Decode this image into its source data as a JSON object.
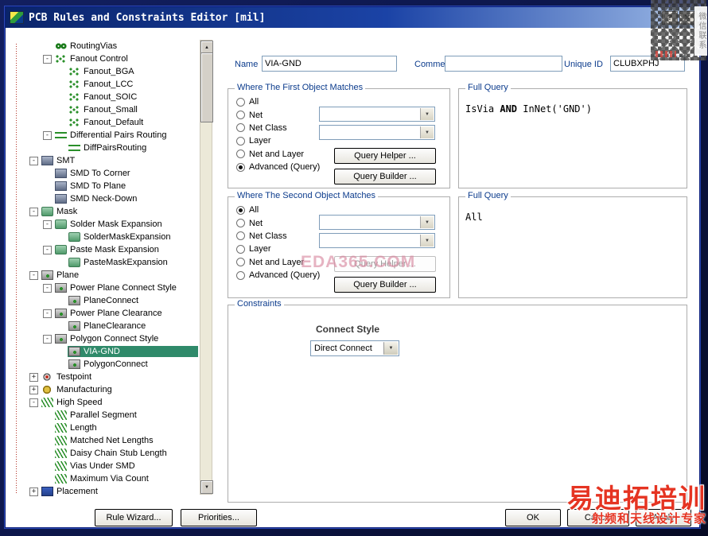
{
  "window": {
    "title": "PCB Rules and Constraints Editor [mil]",
    "help_label": "?",
    "close_label": "✕"
  },
  "form": {
    "name_label": "Name",
    "name_value": "VIA-GND",
    "comment_label": "Comment",
    "comment_value": "",
    "unique_id_label": "Unique ID",
    "unique_id_value": "CLUBXPHJ"
  },
  "first_match": {
    "title": "Where The First Object Matches",
    "options": [
      "All",
      "Net",
      "Net Class",
      "Layer",
      "Net and Layer",
      "Advanced (Query)"
    ],
    "selected": "Advanced (Query)",
    "query_helper_label": "Query Helper ...",
    "query_builder_label": "Query Builder ..."
  },
  "first_query": {
    "title": "Full Query",
    "prefix": "IsVia ",
    "keyword": "AND",
    "suffix": " InNet('GND')"
  },
  "second_match": {
    "title": "Where The Second Object Matches",
    "options": [
      "All",
      "Net",
      "Net Class",
      "Layer",
      "Net and Layer",
      "Advanced (Query)"
    ],
    "selected": "All",
    "query_helper_label": "Query Helper ...",
    "query_builder_label": "Query Builder ..."
  },
  "second_query": {
    "title": "Full Query",
    "text": "All"
  },
  "constraints": {
    "title": "Constraints",
    "connect_style_label": "Connect Style",
    "connect_style_value": "Direct Connect"
  },
  "footer": {
    "rule_wizard_label": "Rule Wizard...",
    "priorities_label": "Priorities...",
    "ok_label": "OK",
    "cancel_label": "Cancel",
    "apply_label": "Apply"
  },
  "watermarks": {
    "center_text": "EDA365.COM",
    "qr_caption": "微信联系",
    "brand_title": "易迪拓培训",
    "brand_subtitle": "射频和天线设计专家"
  },
  "tree": {
    "items": [
      {
        "label": "RoutingVias",
        "level": 2,
        "expand": null,
        "icon": "vias",
        "selected": false
      },
      {
        "label": "Fanout Control",
        "level": 2,
        "expand": "minus",
        "icon": "fanout",
        "selected": false
      },
      {
        "label": "Fanout_BGA",
        "level": 3,
        "expand": null,
        "icon": "fanout",
        "selected": false
      },
      {
        "label": "Fanout_LCC",
        "level": 3,
        "expand": null,
        "icon": "fanout",
        "selected": false
      },
      {
        "label": "Fanout_SOIC",
        "level": 3,
        "expand": null,
        "icon": "fanout",
        "selected": false
      },
      {
        "label": "Fanout_Small",
        "level": 3,
        "expand": null,
        "icon": "fanout",
        "selected": false
      },
      {
        "label": "Fanout_Default",
        "level": 3,
        "expand": null,
        "icon": "fanout",
        "selected": false
      },
      {
        "label": "Differential Pairs Routing",
        "level": 2,
        "expand": "minus",
        "icon": "diffpairs",
        "selected": false
      },
      {
        "label": "DiffPairsRouting",
        "level": 3,
        "expand": null,
        "icon": "diffpairs",
        "selected": false
      },
      {
        "label": "SMT",
        "level": 1,
        "expand": "minus",
        "icon": "smt",
        "selected": false
      },
      {
        "label": "SMD To Corner",
        "level": 2,
        "expand": null,
        "icon": "smt",
        "selected": false
      },
      {
        "label": "SMD To Plane",
        "level": 2,
        "expand": null,
        "icon": "smt",
        "selected": false
      },
      {
        "label": "SMD Neck-Down",
        "level": 2,
        "expand": null,
        "icon": "smt",
        "selected": false
      },
      {
        "label": "Mask",
        "level": 1,
        "expand": "minus",
        "icon": "mask",
        "selected": false
      },
      {
        "label": "Solder Mask Expansion",
        "level": 2,
        "expand": "minus",
        "icon": "mask",
        "selected": false
      },
      {
        "label": "SolderMaskExpansion",
        "level": 3,
        "expand": null,
        "icon": "mask",
        "selected": false
      },
      {
        "label": "Paste Mask Expansion",
        "level": 2,
        "expand": "minus",
        "icon": "mask",
        "selected": false
      },
      {
        "label": "PasteMaskExpansion",
        "level": 3,
        "expand": null,
        "icon": "mask",
        "selected": false
      },
      {
        "label": "Plane",
        "level": 1,
        "expand": "minus",
        "icon": "plane",
        "selected": false
      },
      {
        "label": "Power Plane Connect Style",
        "level": 2,
        "expand": "minus",
        "icon": "plane",
        "selected": false
      },
      {
        "label": "PlaneConnect",
        "level": 3,
        "expand": null,
        "icon": "plane",
        "selected": false
      },
      {
        "label": "Power Plane Clearance",
        "level": 2,
        "expand": "minus",
        "icon": "plane",
        "selected": false
      },
      {
        "label": "PlaneClearance",
        "level": 3,
        "expand": null,
        "icon": "plane",
        "selected": false
      },
      {
        "label": "Polygon Connect Style",
        "level": 2,
        "expand": "minus",
        "icon": "plane",
        "selected": false
      },
      {
        "label": "VIA-GND",
        "level": 3,
        "expand": null,
        "icon": "plane",
        "selected": true
      },
      {
        "label": "PolygonConnect",
        "level": 3,
        "expand": null,
        "icon": "plane",
        "selected": false
      },
      {
        "label": "Testpoint",
        "level": 1,
        "expand": "plus",
        "icon": "testpoint",
        "selected": false
      },
      {
        "label": "Manufacturing",
        "level": 1,
        "expand": "plus",
        "icon": "manufacturing",
        "selected": false
      },
      {
        "label": "High Speed",
        "level": 1,
        "expand": "minus",
        "icon": "highspeed",
        "selected": false
      },
      {
        "label": "Parallel Segment",
        "level": 2,
        "expand": null,
        "icon": "highspeed",
        "selected": false
      },
      {
        "label": "Length",
        "level": 2,
        "expand": null,
        "icon": "highspeed",
        "selected": false
      },
      {
        "label": "Matched Net Lengths",
        "level": 2,
        "expand": null,
        "icon": "highspeed",
        "selected": false
      },
      {
        "label": "Daisy Chain Stub Length",
        "level": 2,
        "expand": null,
        "icon": "highspeed",
        "selected": false
      },
      {
        "label": "Vias Under SMD",
        "level": 2,
        "expand": null,
        "icon": "highspeed",
        "selected": false
      },
      {
        "label": "Maximum Via Count",
        "level": 2,
        "expand": null,
        "icon": "highspeed",
        "selected": false
      },
      {
        "label": "Placement",
        "level": 1,
        "expand": "plus",
        "icon": "placement",
        "selected": false
      }
    ]
  }
}
